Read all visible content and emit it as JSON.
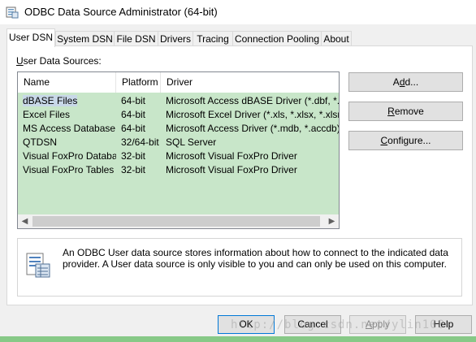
{
  "window": {
    "title": "ODBC Data Source Administrator (64-bit)"
  },
  "tabs": [
    {
      "label": "User DSN"
    },
    {
      "label": "System DSN"
    },
    {
      "label": "File DSN"
    },
    {
      "label": "Drivers"
    },
    {
      "label": "Tracing"
    },
    {
      "label": "Connection Pooling"
    },
    {
      "label": "About"
    }
  ],
  "user_dsn": {
    "section_label_underlined": "U",
    "section_label_rest": "ser Data Sources:",
    "columns": [
      "Name",
      "Platform",
      "Driver"
    ],
    "rows": [
      {
        "name": "dBASE Files",
        "platform": "64-bit",
        "driver": "Microsoft Access dBASE Driver (*.dbf, *.ndx, *.mdx)"
      },
      {
        "name": "Excel Files",
        "platform": "64-bit",
        "driver": "Microsoft Excel Driver (*.xls, *.xlsx, *.xlsm, *.xlsb)"
      },
      {
        "name": "MS Access Database",
        "platform": "64-bit",
        "driver": "Microsoft Access Driver (*.mdb, *.accdb)"
      },
      {
        "name": "QTDSN",
        "platform": "32/64-bit",
        "driver": "SQL Server"
      },
      {
        "name": "Visual FoxPro Database",
        "platform": "32-bit",
        "driver": "Microsoft Visual FoxPro Driver"
      },
      {
        "name": "Visual FoxPro Tables",
        "platform": "32-bit",
        "driver": "Microsoft Visual FoxPro Driver"
      }
    ],
    "buttons": {
      "add_pre": "A",
      "add_ul": "d",
      "add_post": "d...",
      "remove_ul": "R",
      "remove_post": "emove",
      "configure_ul": "C",
      "configure_post": "onfigure..."
    },
    "info_text": "An ODBC User data source stores information about how to connect to the indicated data provider.   A User data source is only visible to you and can only be used on this computer."
  },
  "footer": {
    "ok": "OK",
    "cancel": "Cancel",
    "apply_ul": "A",
    "apply_post": "pply",
    "help": "Help"
  },
  "watermark": "http://blog.csdn.net/ylin100",
  "icons": {
    "app": "odbc-app-icon",
    "info": "data-source-document-icon"
  },
  "colors": {
    "list_background": "#c8e6c9",
    "accent": "#0078d7"
  }
}
